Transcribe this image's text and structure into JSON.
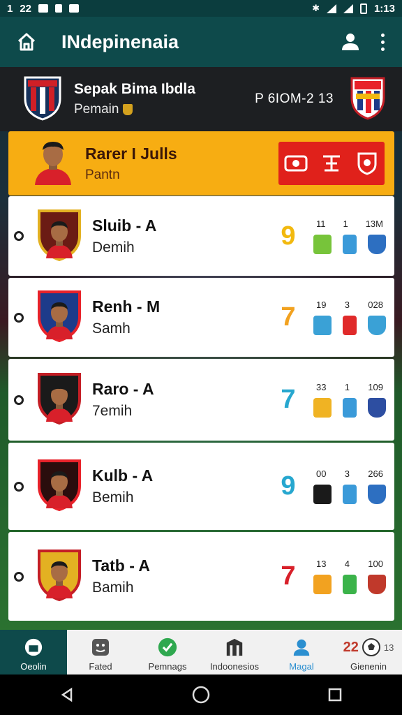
{
  "status_bar": {
    "left_texts": [
      "1",
      "22"
    ],
    "time": "1:13"
  },
  "app_bar": {
    "title": "INdepinenaia"
  },
  "match": {
    "title": "Sepak Bima Ibdla",
    "subtitle": "Pemain",
    "score": "P 6IOM-2 13",
    "left_colors": [
      "#16325c",
      "#d01f26"
    ],
    "right_colors": [
      "#1d3b8a",
      "#e8222a"
    ]
  },
  "featured": {
    "name": "Rarer I Julls",
    "role": "Pantn"
  },
  "players": [
    {
      "name": "Sluib - A",
      "role": "Demih",
      "number": "9",
      "number_color": "#f2b90f",
      "stats": [
        "11",
        "1",
        "13M"
      ],
      "icon_colors": [
        "#77c43a",
        "#3a9ad9",
        "#2d6fc1"
      ],
      "crest": [
        "#6b1b14",
        "#e3b122"
      ]
    },
    {
      "name": "Renh - M",
      "role": "Samh",
      "number": "7",
      "number_color": "#f2a220",
      "stats": [
        "19",
        "3",
        "028"
      ],
      "icon_colors": [
        "#3aa1d6",
        "#e02a2a",
        "#3aa1d6"
      ],
      "crest": [
        "#1d3b8a",
        "#e8222a"
      ]
    },
    {
      "name": "Raro - A",
      "role": "7emih",
      "number": "7",
      "number_color": "#27a7cf",
      "stats": [
        "33",
        "1",
        "109"
      ],
      "icon_colors": [
        "#f0b323",
        "#3a9ad9",
        "#2d4ea1"
      ],
      "crest": [
        "#1a1a1a",
        "#c41e25"
      ]
    },
    {
      "name": "Kulb - A",
      "role": "Bemih",
      "number": "9",
      "number_color": "#27a7cf",
      "stats": [
        "00",
        "3",
        "266"
      ],
      "icon_colors": [
        "#1a1a1a",
        "#3a9ad9",
        "#2d6fc1"
      ],
      "crest": [
        "#2a0d0d",
        "#e8222a"
      ]
    },
    {
      "name": "Tatb - A",
      "role": "Bamih",
      "number": "7",
      "number_color": "#d8202a",
      "stats": [
        "13",
        "4",
        "100"
      ],
      "icon_colors": [
        "#f2a220",
        "#3bb34a",
        "#c0392b"
      ],
      "crest": [
        "#e3b122",
        "#c41e25"
      ]
    }
  ],
  "bottom_nav": [
    {
      "label": "Oeolin"
    },
    {
      "label": "Fated"
    },
    {
      "label": "Pemnags"
    },
    {
      "label": "Indoonesios"
    },
    {
      "label": "Magal"
    },
    {
      "label": "Gienenin",
      "badge": "22",
      "badge2": "13"
    }
  ]
}
